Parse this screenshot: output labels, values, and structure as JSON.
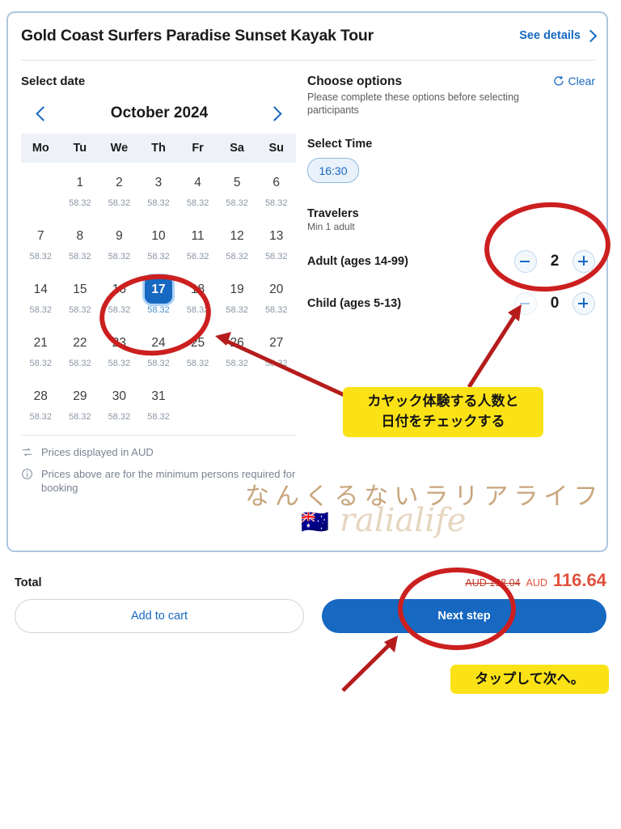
{
  "card": {
    "title": "Gold Coast Surfers Paradise Sunset Kayak Tour",
    "see_details": "See details",
    "see_details_icon": "chevron-right-icon"
  },
  "left": {
    "select_date_label": "Select date",
    "calendar": {
      "month": "October 2024",
      "prev_icon": "chevron-left-icon",
      "next_icon": "chevron-right-icon",
      "weekdays": [
        "Mo",
        "Tu",
        "We",
        "Th",
        "Fr",
        "Sa",
        "Su"
      ],
      "lead_blanks": 1,
      "selected_day": 17,
      "price_per_day": "58.32",
      "days": [
        {
          "day": 1,
          "price": "58.32"
        },
        {
          "day": 2,
          "price": "58.32"
        },
        {
          "day": 3,
          "price": "58.32"
        },
        {
          "day": 4,
          "price": "58.32"
        },
        {
          "day": 5,
          "price": "58.32"
        },
        {
          "day": 6,
          "price": "58.32"
        },
        {
          "day": 7,
          "price": "58.32"
        },
        {
          "day": 8,
          "price": "58.32"
        },
        {
          "day": 9,
          "price": "58.32"
        },
        {
          "day": 10,
          "price": "58.32"
        },
        {
          "day": 11,
          "price": "58.32"
        },
        {
          "day": 12,
          "price": "58.32"
        },
        {
          "day": 13,
          "price": "58.32"
        },
        {
          "day": 14,
          "price": "58.32"
        },
        {
          "day": 15,
          "price": "58.32"
        },
        {
          "day": 16,
          "price": "58.32"
        },
        {
          "day": 17,
          "price": "58.32"
        },
        {
          "day": 18,
          "price": "58.32"
        },
        {
          "day": 19,
          "price": "58.32"
        },
        {
          "day": 20,
          "price": "58.32"
        },
        {
          "day": 21,
          "price": "58.32"
        },
        {
          "day": 22,
          "price": "58.32"
        },
        {
          "day": 23,
          "price": "58.32"
        },
        {
          "day": 24,
          "price": "58.32"
        },
        {
          "day": 25,
          "price": "58.32"
        },
        {
          "day": 26,
          "price": "58.32"
        },
        {
          "day": 27,
          "price": "58.32"
        },
        {
          "day": 28,
          "price": "58.32"
        },
        {
          "day": 29,
          "price": "58.32"
        },
        {
          "day": 30,
          "price": "58.32"
        },
        {
          "day": 31,
          "price": "58.32"
        }
      ]
    },
    "notes": [
      {
        "icon": "currency-exchange-icon",
        "text": "Prices displayed in AUD"
      },
      {
        "icon": "info-circle-icon",
        "text": "Prices above are for the minimum persons required for booking"
      }
    ]
  },
  "right": {
    "options_title": "Choose options",
    "options_subtitle": "Please complete these options before selecting participants",
    "clear_label": "Clear",
    "clear_icon": "reset-circle-icon",
    "select_time_label": "Select Time",
    "time_value": "16:30",
    "travelers_label": "Travelers",
    "travelers_min": "Min 1 adult",
    "pax": [
      {
        "label": "Adult (ages 14-99)",
        "count": "2",
        "minus_disabled": false,
        "plus_disabled": false
      },
      {
        "label": "Child (ages 5-13)",
        "count": "0",
        "minus_disabled": true,
        "plus_disabled": false
      }
    ]
  },
  "footer": {
    "total_label": "Total",
    "price_old": "AUD 138.04",
    "price_currency": "AUD",
    "price_new": "116.64",
    "add_to_cart": "Add to cart",
    "next_step": "Next step"
  },
  "annotations": {
    "travelers_note_line1": "カヤック体験する人数と",
    "travelers_note_line2": "日付をチェックする",
    "tap_note": "タップして次へ。"
  },
  "watermark": {
    "jp": "なんくるないラリアライフ",
    "script": "ralialife",
    "flag": "🇦🇺"
  },
  "colors": {
    "accent_blue": "#1668c1",
    "annotation_yellow": "#fbe216",
    "annotation_red": "#cc1f1f",
    "price_red": "#e1523d"
  }
}
